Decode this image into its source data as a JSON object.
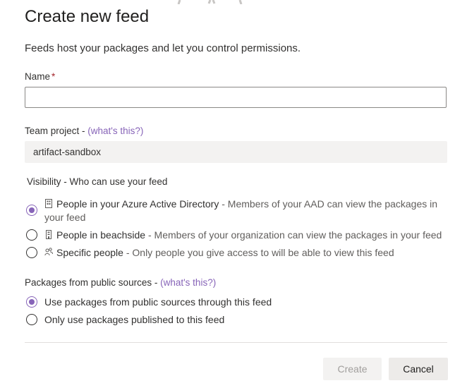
{
  "dialog": {
    "title": "Create new feed",
    "subtitle": "Feeds host your packages and let you control permissions."
  },
  "name_field": {
    "label": "Name",
    "required_mark": "*",
    "value": ""
  },
  "team_project": {
    "label": "Team project - ",
    "help_link": "(what's this?)",
    "value": "artifact-sandbox"
  },
  "visibility": {
    "label": "Visibility - Who can use your feed",
    "options": [
      {
        "icon": "organization-icon",
        "title": "People in your Azure Active Directory",
        "description_line1": " - Members of your AAD can view the packages in",
        "description_line2": "your feed",
        "selected": true
      },
      {
        "icon": "building-icon",
        "title": "People in beachside",
        "description": " - Members of your organization can view the packages in your feed",
        "selected": false
      },
      {
        "icon": "people-icon",
        "title": "Specific people",
        "description": " - Only people you give access to will be able to view this feed",
        "selected": false
      }
    ]
  },
  "public_sources": {
    "label": "Packages from public sources - ",
    "help_link": "(what's this?)",
    "options": [
      {
        "label": "Use packages from public sources through this feed",
        "selected": true
      },
      {
        "label": "Only use packages published to this feed",
        "selected": false
      }
    ]
  },
  "actions": {
    "create_label": "Create",
    "cancel_label": "Cancel"
  },
  "colors": {
    "accent": "#8764b8",
    "required": "#a4262c",
    "disabled_bg": "#f3f2f1",
    "disabled_text": "#a19f9d"
  }
}
